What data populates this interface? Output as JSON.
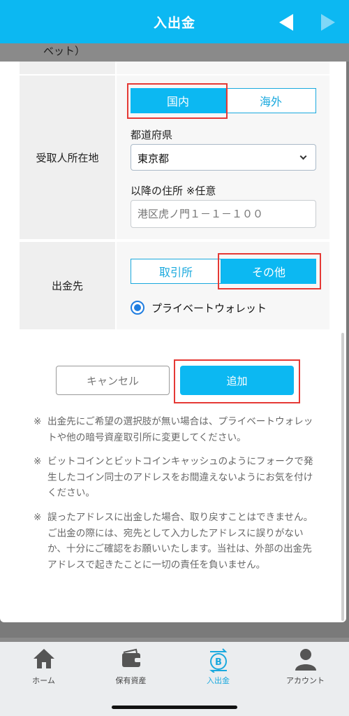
{
  "header": {
    "title": "入出金"
  },
  "overlay": {
    "partial_label": "ベット）"
  },
  "address": {
    "label": "受取人所在地",
    "tab_domestic": "国内",
    "tab_overseas": "海外",
    "prefecture_label": "都道府県",
    "prefecture_value": "東京都",
    "address_label": "以降の住所 ※任意",
    "address_placeholder": "港区虎ノ門１－１－１００"
  },
  "destination": {
    "label": "出金先",
    "tab_exchange": "取引所",
    "tab_other": "その他",
    "radio_label": "プライベートウォレット"
  },
  "buttons": {
    "cancel": "キャンセル",
    "add": "追加"
  },
  "notes": [
    {
      "mark": "※",
      "text": "出金先にご希望の選択肢が無い場合は、プライベートウォレットや他の暗号資産取引所に変更してください。"
    },
    {
      "mark": "※",
      "text": "ビットコインとビットコインキャッシュのようにフォークで発生したコイン同士のアドレスをお間違えないようにお気を付けください。"
    },
    {
      "mark": "※",
      "text": "誤ったアドレスに出金した場合、取り戻すことはできません。ご出金の際には、宛先として入力したアドレスに誤りがないか、十分にご確認をお願いいたします。当社は、外部の出金先アドレスで起きたことに一切の責任を負いません。"
    }
  ],
  "nav": [
    {
      "label": "ホーム",
      "icon": "home-icon"
    },
    {
      "label": "保有資産",
      "icon": "wallet-icon"
    },
    {
      "label": "入出金",
      "icon": "bitcoin-transfer-icon"
    },
    {
      "label": "アカウント",
      "icon": "account-icon"
    }
  ],
  "colors": {
    "accent": "#0cb8f2",
    "highlight": "#e53935",
    "radio": "#1f7de0"
  }
}
